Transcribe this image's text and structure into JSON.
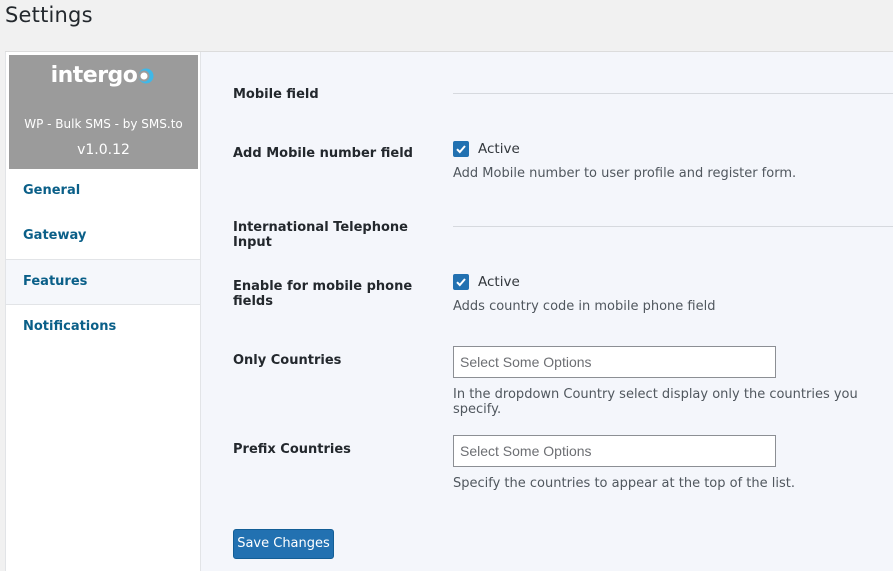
{
  "page": {
    "title": "Settings"
  },
  "sidebar": {
    "logo_text": "intergo",
    "plugin_name": "WP - Bulk SMS - by SMS.to",
    "version": "v1.0.12",
    "items": [
      {
        "label": "General",
        "active": false
      },
      {
        "label": "Gateway",
        "active": false
      },
      {
        "label": "Features",
        "active": true
      },
      {
        "label": "Notifications",
        "active": false
      }
    ]
  },
  "form": {
    "mobile_section": "Mobile field",
    "add_mobile": {
      "label": "Add Mobile number field",
      "checked": true,
      "check_label": "Active",
      "description": "Add Mobile number to user profile and register form."
    },
    "intl_section": "International Telephone Input",
    "enable_mobile": {
      "label": "Enable for mobile phone fields",
      "checked": true,
      "check_label": "Active",
      "description": "Adds country code in mobile phone field"
    },
    "only_countries": {
      "label": "Only Countries",
      "placeholder": "Select Some Options",
      "description": "In the dropdown Country select display only the countries you specify."
    },
    "prefix_countries": {
      "label": "Prefix Countries",
      "placeholder": "Select Some Options",
      "description": "Specify the countries to appear at the top of the list."
    },
    "save_label": "Save Changes"
  },
  "colors": {
    "accent": "#2271b1",
    "nav_link": "#0a5f88",
    "brand_bg": "#9b9b9b"
  }
}
